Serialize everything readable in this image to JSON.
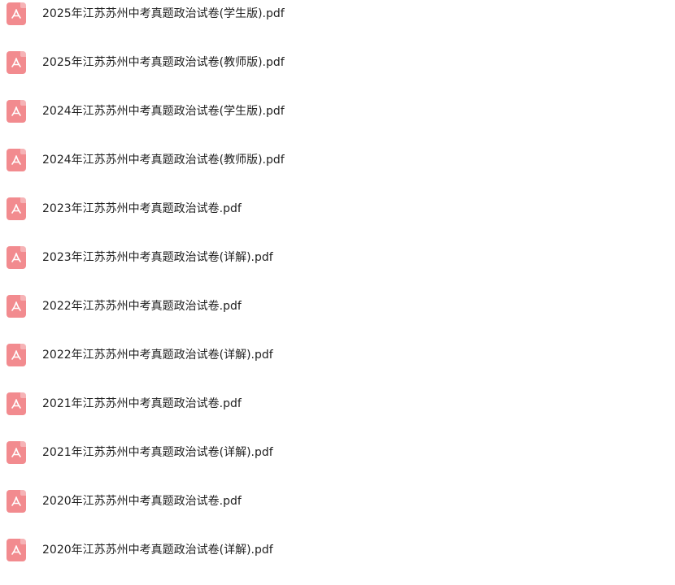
{
  "files": [
    {
      "name": "2025年江苏苏州中考真题政治试卷(学生版).pdf",
      "icon": "pdf-icon"
    },
    {
      "name": "2025年江苏苏州中考真题政治试卷(教师版).pdf",
      "icon": "pdf-icon"
    },
    {
      "name": "2024年江苏苏州中考真题政治试卷(学生版).pdf",
      "icon": "pdf-icon"
    },
    {
      "name": "2024年江苏苏州中考真题政治试卷(教师版).pdf",
      "icon": "pdf-icon"
    },
    {
      "name": "2023年江苏苏州中考真题政治试卷.pdf",
      "icon": "pdf-icon"
    },
    {
      "name": "2023年江苏苏州中考真题政治试卷(详解).pdf",
      "icon": "pdf-icon"
    },
    {
      "name": "2022年江苏苏州中考真题政治试卷.pdf",
      "icon": "pdf-icon"
    },
    {
      "name": "2022年江苏苏州中考真题政治试卷(详解).pdf",
      "icon": "pdf-icon"
    },
    {
      "name": "2021年江苏苏州中考真题政治试卷.pdf",
      "icon": "pdf-icon"
    },
    {
      "name": "2021年江苏苏州中考真题政治试卷(详解).pdf",
      "icon": "pdf-icon"
    },
    {
      "name": "2020年江苏苏州中考真题政治试卷.pdf",
      "icon": "pdf-icon"
    },
    {
      "name": "2020年江苏苏州中考真题政治试卷(详解).pdf",
      "icon": "pdf-icon"
    }
  ],
  "colors": {
    "pdf_icon": "#f28b8f",
    "text": "#1f1f1f",
    "background": "#ffffff"
  }
}
